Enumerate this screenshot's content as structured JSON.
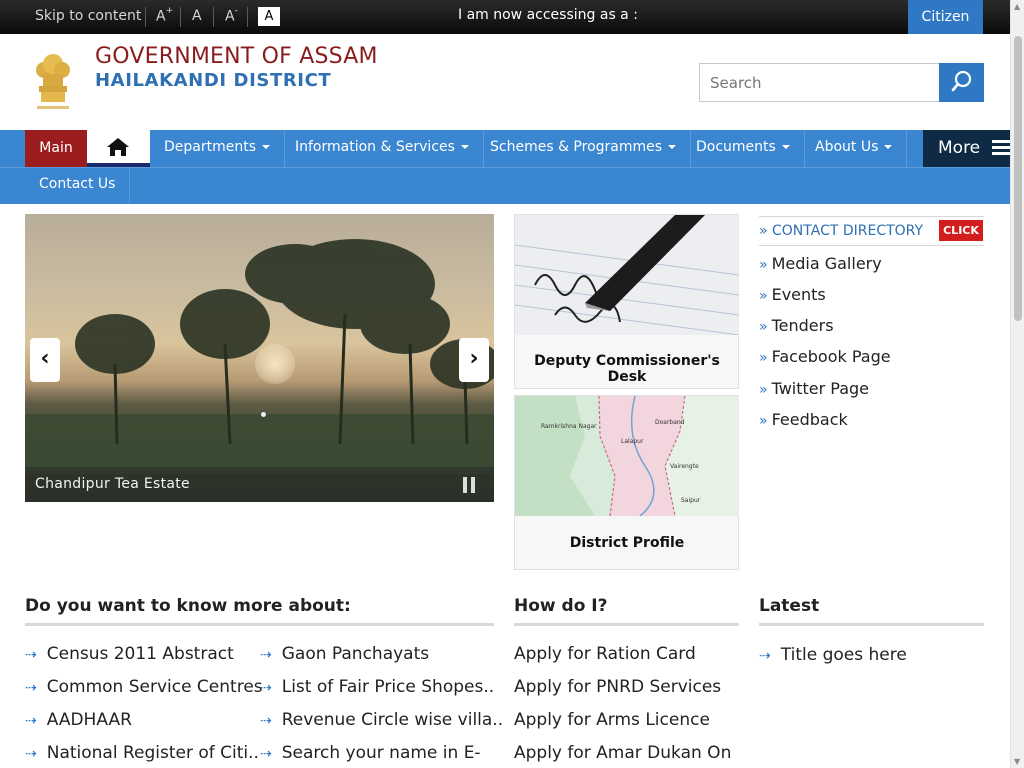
{
  "topbar": {
    "skip": "Skip to content",
    "font_increase": "A",
    "font_increase_sup": "+",
    "font_normal": "A",
    "font_decrease": "A",
    "font_decrease_sup": "-",
    "contrast": "A",
    "accessing_as": "I am now accessing as a :",
    "citizen": "Citizen"
  },
  "header": {
    "gov_title": "GOVERNMENT OF ASSAM",
    "district_title": "HAILAKANDI DISTRICT",
    "search_placeholder": "Search"
  },
  "nav": {
    "main": "Main",
    "items": [
      "Departments",
      "Information & Services",
      "Schemes & Programmes",
      "Documents",
      "About Us"
    ],
    "more": "More",
    "contact": "Contact Us"
  },
  "slider": {
    "caption": "Chandipur Tea Estate"
  },
  "cards": {
    "dc_desk": "Deputy Commissioner's Desk",
    "district_profile": "District Profile",
    "map_labels": [
      "Ramkrishna Nagar",
      "Lalapur",
      "Doarband",
      "Vairengte",
      "Saipur"
    ]
  },
  "right_links": {
    "contact_directory": "» CONTACT DIRECTORY",
    "click": "CLICK",
    "raquo": "»",
    "items": [
      "Media Gallery",
      "Events",
      "Tenders",
      "Facebook Page",
      "Twitter Page",
      "Feedback"
    ]
  },
  "know_more": {
    "title": "Do you want to know more about:",
    "col1": [
      "Census 2011 Abstract",
      "Common Service Centres",
      "AADHAAR",
      "National Register of Citi.."
    ],
    "col2": [
      "Gaon Panchayats",
      "List of Fair Price Shopes..",
      "Revenue Circle wise villa..",
      "Search your name in E-"
    ]
  },
  "how_do_i": {
    "title": "How do I?",
    "items": [
      "Apply for Ration Card",
      "Apply for PNRD Services",
      "Apply for Arms Licence",
      "Apply for Amar Dukan On"
    ]
  },
  "latest": {
    "title": "Latest",
    "items": [
      "Title goes here"
    ]
  },
  "colors": {
    "nav_blue": "#3a86d1",
    "main_red": "#9b1d1d",
    "title_red": "#8a1c1c",
    "title_blue": "#2f6fb3",
    "click_red": "#d41d1d",
    "more_dark": "#0f2a44"
  }
}
